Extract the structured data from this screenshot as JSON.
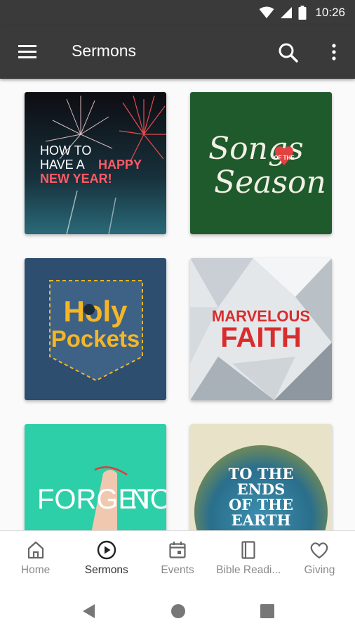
{
  "status_bar": {
    "time": "10:26",
    "icons": [
      "wifi-icon",
      "cellular-icon",
      "battery-icon"
    ]
  },
  "app_bar": {
    "title": "Sermons",
    "menu_icon": "hamburger-menu-icon",
    "search_icon": "search-icon",
    "more_icon": "more-vert-icon"
  },
  "series": [
    {
      "name": "How to Have a Happy New Year",
      "art_lines": [
        "HOW TO",
        "HAVE A",
        "HAPPY",
        "NEW YEAR!"
      ],
      "colors": {
        "bg": "#163746",
        "accent": "#ff5a66"
      }
    },
    {
      "name": "Songs of the Season",
      "art_lines": [
        "Songs",
        "OF THE",
        "Season"
      ],
      "colors": {
        "bg": "#1f5a2c",
        "accent": "#e24141"
      }
    },
    {
      "name": "Holy Pockets",
      "art_lines": [
        "Holy",
        "Pockets"
      ],
      "colors": {
        "bg": "#2e4e6f",
        "accent": "#f5b626"
      }
    },
    {
      "name": "Marvelous Faith",
      "art_lines": [
        "MARVELOUS",
        "FAITH"
      ],
      "colors": {
        "bg": "#e4e7ea",
        "accent": "#d82d2d"
      }
    },
    {
      "name": "Forget Not",
      "art_lines": [
        "FORGET",
        "NOT"
      ],
      "colors": {
        "bg": "#2dcfa8",
        "accent": "#ffffff"
      }
    },
    {
      "name": "To the Ends of the Earth",
      "art_lines": [
        "TO THE",
        "ENDS",
        "OF THE",
        "EARTH"
      ],
      "colors": {
        "bg": "#e8e2c8",
        "accent": "#ffffff"
      }
    }
  ],
  "bottom_nav": {
    "items": [
      {
        "label": "Home",
        "icon": "home-icon",
        "active": false
      },
      {
        "label": "Sermons",
        "icon": "play-circle-icon",
        "active": true
      },
      {
        "label": "Events",
        "icon": "calendar-icon",
        "active": false
      },
      {
        "label": "Bible Readi...",
        "icon": "book-icon",
        "active": false
      },
      {
        "label": "Giving",
        "icon": "heart-icon",
        "active": false
      }
    ]
  },
  "system_nav": {
    "buttons": [
      "back-icon",
      "home-circle-icon",
      "recents-square-icon"
    ]
  }
}
